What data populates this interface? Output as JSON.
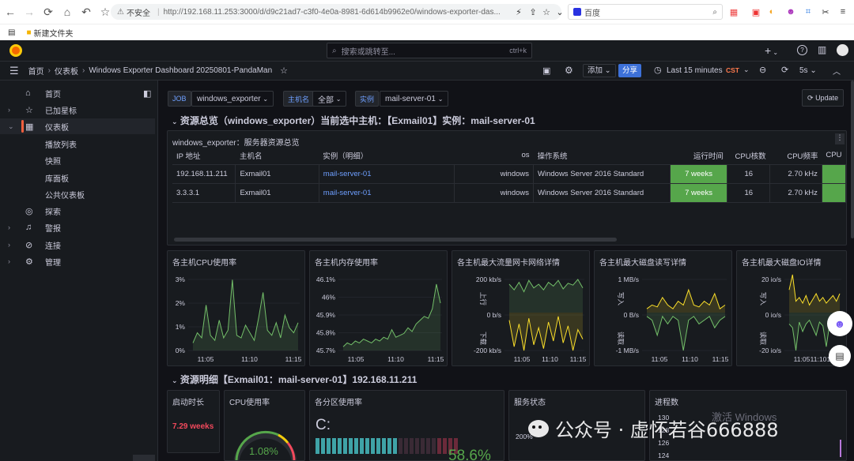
{
  "browser": {
    "security_label": "不安全",
    "url": "http://192.168.11.253:3000/d/d9c21ad7-c3f0-4e0a-8981-6d614b9962e0/windows-exporter-das...",
    "search_engine": "百度",
    "bookmark": "新建文件夹"
  },
  "topbar": {
    "search_placeholder": "搜索或跳转至...",
    "search_shortcut": "ctrl+k",
    "plus": "+"
  },
  "navbar": {
    "breadcrumbs": [
      "首页",
      "仪表板",
      "Windows Exporter Dashboard 20250801-PandaMan"
    ],
    "add_label": "添加",
    "share_label": "分享",
    "time_range": "Last 15 minutes",
    "timezone": "CST",
    "refresh": "5s"
  },
  "sidebar": {
    "items": [
      {
        "label": "首页",
        "icon": "home-icon"
      },
      {
        "label": "已加星标",
        "icon": "star-icon"
      },
      {
        "label": "仪表板",
        "icon": "dashboard-grid-icon"
      },
      {
        "label": "播放列表"
      },
      {
        "label": "快照"
      },
      {
        "label": "库面板"
      },
      {
        "label": "公共仪表板"
      },
      {
        "label": "探索",
        "icon": "compass-icon"
      },
      {
        "label": "警报",
        "icon": "bell-icon"
      },
      {
        "label": "连接",
        "icon": "link-icon"
      },
      {
        "label": "管理",
        "icon": "gear-icon"
      }
    ]
  },
  "variables": {
    "job_label": "JOB",
    "job_value": "windows_exporter",
    "host_label": "主机名",
    "host_value": "全部",
    "instance_label": "实例",
    "instance_value": "mail-server-01",
    "update_label": "Update"
  },
  "row1": {
    "title": "资源总览（windows_exporter）当前选中主机：【Exmail01】实例：mail-server-01",
    "table_title": "windows_exporter：服务器资源总览",
    "columns": [
      "IP 地址",
      "主机名",
      "实例（明细）",
      "os",
      "操作系统",
      "运行时间",
      "CPU核数",
      "CPU频率",
      "CPU"
    ],
    "rows": [
      [
        "192.168.11.211",
        "Exmail01",
        "mail-server-01",
        "windows",
        "Windows Server 2016 Standard",
        "7 weeks",
        "16",
        "2.70 kHz"
      ],
      [
        "3.3.3.1",
        "Exmail01",
        "mail-server-01",
        "windows",
        "Windows Server 2016 Standard",
        "7 weeks",
        "16",
        "2.70 kHz"
      ]
    ]
  },
  "charts": {
    "cpu": {
      "title": "各主机CPU使用率",
      "ticks": [
        "3%",
        "2%",
        "1%",
        "0%"
      ],
      "xticks": [
        "11:05",
        "11:10",
        "11:15"
      ]
    },
    "mem": {
      "title": "各主机内存使用率",
      "ticks": [
        "46.1%",
        "46%",
        "45.9%",
        "45.8%",
        "45.7%"
      ],
      "xticks": [
        "11:05",
        "11:10",
        "11:15"
      ]
    },
    "net": {
      "title": "各主机最大流量网卡网络详情",
      "ticks": [
        "200 kb/s",
        "0 b/s",
        "-200 kb/s"
      ],
      "xticks": [
        "11:05",
        "11:10",
        "11:15"
      ],
      "y_top": "上行",
      "y_bottom": "下载"
    },
    "disk": {
      "title": "各主机最大磁盘读写详情",
      "ticks": [
        "1 MB/s",
        "0 B/s",
        "-1 MB/s"
      ],
      "xticks": [
        "11:05",
        "11:10",
        "11:15"
      ],
      "y_top": "写入",
      "y_bottom": "读取"
    },
    "io": {
      "title": "各主机最大磁盘IO详情",
      "ticks": [
        "20 io/s",
        "0 io/s",
        "-20 io/s"
      ],
      "xticks": [
        "11:05",
        "11:10",
        "11:15"
      ],
      "y_top": "写入",
      "y_bottom": "读取"
    }
  },
  "chart_data": [
    {
      "type": "line",
      "title": "各主机CPU使用率",
      "x": [
        "11:05",
        "11:10",
        "11:15"
      ],
      "ylim": [
        0,
        3
      ],
      "series": [
        {
          "values": [
            0.3,
            0.7,
            0.5,
            1.8,
            0.6,
            0.4,
            1.2,
            0.5,
            0.8,
            2.8,
            0.6,
            0.5,
            1.0,
            0.7,
            0.4,
            1.3,
            2.3,
            0.8,
            0.6,
            1.1,
            0.5,
            1.4,
            0.9,
            0.7,
            1.1
          ]
        }
      ]
    },
    {
      "type": "line",
      "title": "各主机内存使用率",
      "x": [
        "11:05",
        "11:10",
        "11:15"
      ],
      "ylim": [
        45.7,
        46.1
      ],
      "series": [
        {
          "values": [
            45.72,
            45.74,
            45.73,
            45.75,
            45.74,
            45.76,
            45.75,
            45.74,
            45.76,
            45.75,
            45.77,
            45.76,
            45.81,
            45.77,
            45.78,
            45.79,
            45.82,
            45.8,
            45.84,
            45.86,
            45.88,
            45.87,
            45.92,
            46.05,
            45.95
          ]
        }
      ]
    },
    {
      "type": "line",
      "title": "各主机最大流量网卡网络详情",
      "x": [
        "11:05",
        "11:10",
        "11:15"
      ],
      "ylim": [
        -200,
        200
      ],
      "series": [
        {
          "name": "上行",
          "values": [
            150,
            120,
            160,
            110,
            170,
            130,
            150,
            120,
            160,
            140,
            170,
            125,
            155,
            145,
            175,
            130
          ]
        },
        {
          "name": "下载",
          "values": [
            -40,
            -180,
            -60,
            -200,
            -30,
            -170,
            -80,
            -190,
            -50,
            -150,
            -20,
            -160,
            -70,
            -200,
            -90,
            -140
          ]
        }
      ]
    },
    {
      "type": "line",
      "title": "各主机最大磁盘读写详情",
      "x": [
        "11:05",
        "11:10",
        "11:15"
      ],
      "ylim": [
        -1,
        1
      ],
      "series": [
        {
          "name": "写入",
          "values": [
            0.1,
            0.2,
            0.15,
            0.4,
            0.2,
            0.1,
            0.3,
            0.2,
            0.6,
            0.2,
            0.15,
            0.3,
            0.2,
            0.5,
            0.1,
            0.2
          ]
        },
        {
          "name": "读取",
          "values": [
            -0.1,
            -0.2,
            -0.6,
            -0.1,
            -0.3,
            -0.1,
            -0.2,
            -1.1,
            -0.2,
            -0.1,
            -0.3,
            -0.2,
            -0.1,
            -0.4,
            -0.2,
            -0.1
          ]
        }
      ]
    },
    {
      "type": "line",
      "title": "各主机最大磁盘IO详情",
      "x": [
        "11:05",
        "11:10",
        "11:15"
      ],
      "ylim": [
        -20,
        20
      ],
      "series": [
        {
          "name": "写入",
          "values": [
            12,
            20,
            6,
            8,
            5,
            9,
            4,
            7,
            10,
            6,
            8,
            5,
            7,
            9,
            6,
            10
          ]
        },
        {
          "name": "读取",
          "values": [
            -6,
            -8,
            -25,
            -5,
            -10,
            -6,
            -4,
            -8,
            -12,
            -5,
            -7,
            -18,
            -6,
            -4,
            -9,
            -5
          ]
        }
      ]
    }
  ],
  "row2": {
    "title": "资源明细【Exmail01：mail-server-01】192.168.11.211",
    "uptime_title": "启动时长",
    "uptime_value": "7.29 weeks",
    "cpu_title": "CPU使用率",
    "cpu_value": "1.08%",
    "partition_title": "各分区使用率",
    "partition_drive": "C:",
    "partition_value": "58.6%",
    "service_title": "服务状态",
    "service_tick": "200%",
    "proc_title": "进程数",
    "proc_ticks": [
      "130",
      "128",
      "126",
      "124"
    ]
  },
  "watermark": {
    "wechat": "公众号 · 虚怀若谷666888",
    "activate": "激活 Windows"
  }
}
